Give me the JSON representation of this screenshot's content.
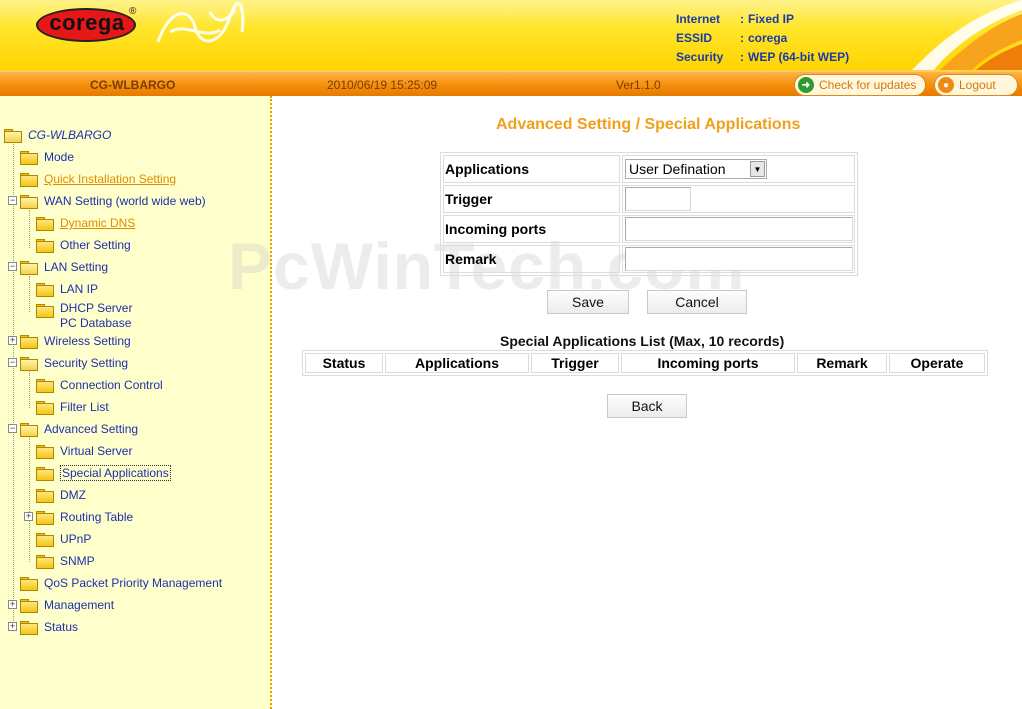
{
  "header": {
    "logo_text": "corega",
    "logo_mark": "®",
    "internet_label": "Internet",
    "internet_value": "Fixed IP",
    "essid_label": "ESSID",
    "essid_value": "corega",
    "security_label": "Security",
    "security_value": "WEP (64-bit WEP)",
    "separator": ":"
  },
  "topbar": {
    "device": "CG-WLBARGO",
    "datetime": "2010/06/19 15:25:09",
    "version": "Ver1.1.0",
    "check_updates": "Check for updates",
    "logout": "Logout"
  },
  "sidebar": {
    "root": "CG-WLBARGO",
    "mode": "Mode",
    "quick_install": "Quick Installation Setting",
    "wan": "WAN Setting (world wide web)",
    "dynamic_dns": "Dynamic DNS",
    "other_setting": "Other Setting",
    "lan": "LAN Setting",
    "lan_ip": "LAN IP",
    "dhcp_server": "DHCP Server",
    "pc_database": "PC Database",
    "wireless": "Wireless Setting",
    "security": "Security Setting",
    "connection_control": "Connection Control",
    "filter_list": "Filter List",
    "advanced": "Advanced Setting",
    "virtual_server": "Virtual Server",
    "special_apps": "Special Applications",
    "dmz": "DMZ",
    "routing_table": "Routing Table",
    "upnp": "UPnP",
    "snmp": "SNMP",
    "qos": "QoS Packet Priority Management",
    "management": "Management",
    "status": "Status"
  },
  "main": {
    "watermark": "PcWinTech.com",
    "title": "Advanced Setting / Special Applications",
    "form": {
      "applications_label": "Applications",
      "applications_value": "User Defination",
      "trigger_label": "Trigger",
      "incoming_label": "Incoming ports",
      "remark_label": "Remark"
    },
    "save": "Save",
    "cancel": "Cancel",
    "list_title": "Special Applications List (Max, 10 records)",
    "list_columns": [
      "Status",
      "Applications",
      "Trigger",
      "Incoming ports",
      "Remark",
      "Operate"
    ],
    "back": "Back"
  },
  "colors": {
    "accent_orange": "#f0a01a",
    "link_blue": "#1c2fae",
    "sidebar_bg": "#ffffcc"
  }
}
